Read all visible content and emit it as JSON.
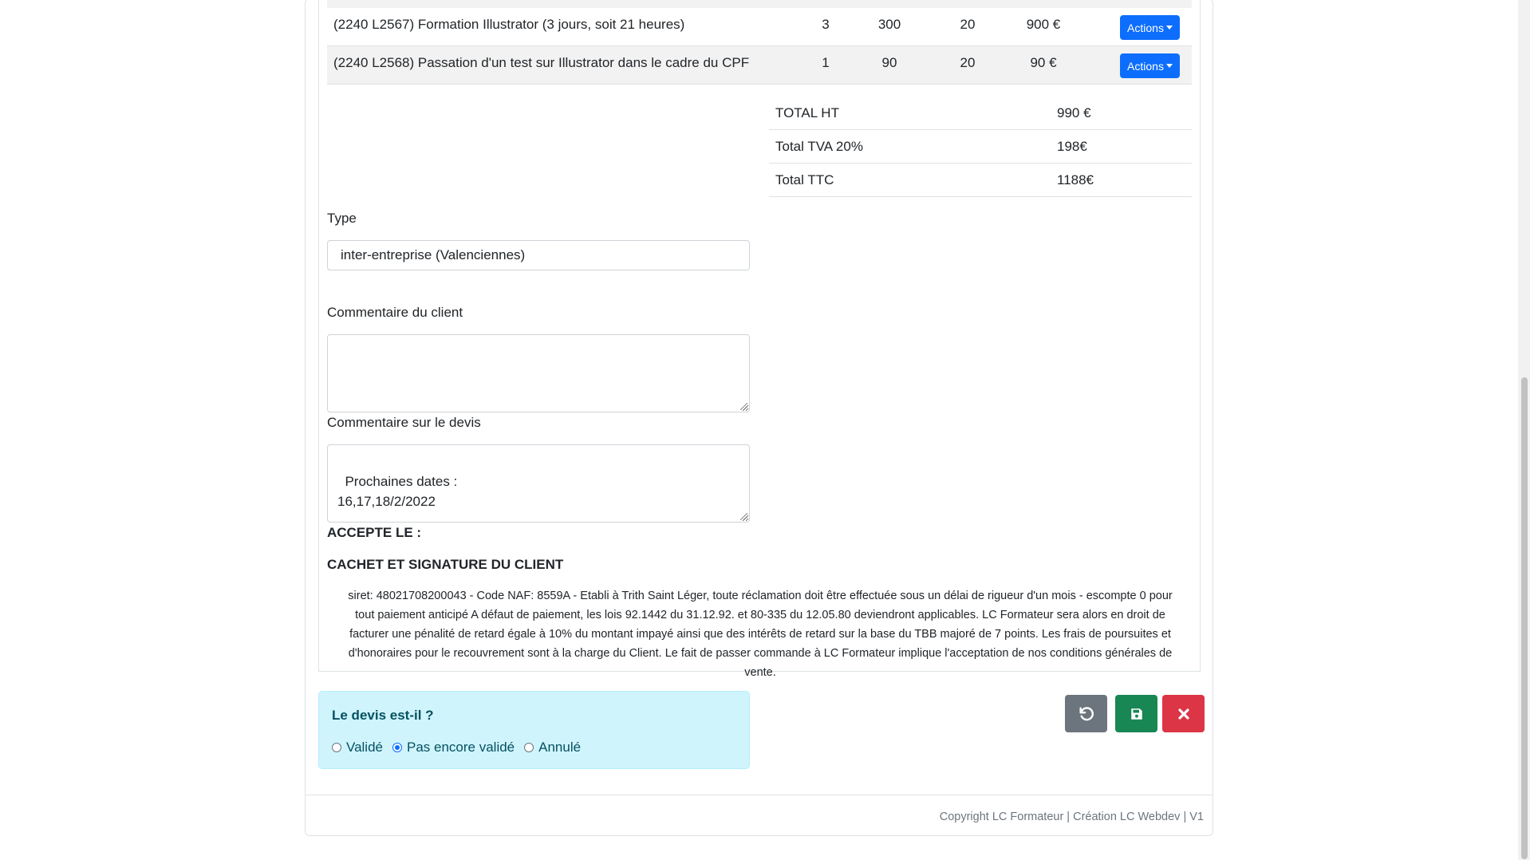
{
  "lines": [
    {
      "designation": "(2240 L2567) Formation Illustrator (3 jours, soit 21 heures)",
      "qty": "3",
      "price": "300",
      "vat": "20",
      "total": "900 €",
      "actions_label": "Actions"
    },
    {
      "designation": "(2240 L2568) Passation d'un test sur Illustrator dans le cadre du CPF",
      "qty": "1",
      "price": "90",
      "vat": "20",
      "total": "90 €",
      "actions_label": "Actions"
    }
  ],
  "totals": [
    {
      "label": "TOTAL HT",
      "value": "990 €"
    },
    {
      "label": "Total TVA 20%",
      "value": "198€"
    },
    {
      "label": "Total TTC",
      "value": "1188€"
    }
  ],
  "form": {
    "type_label": "Type",
    "type_value": "inter-entreprise (Valenciennes)",
    "client_comment_label": "Commentaire du client",
    "client_comment_value": "",
    "quote_comment_label": "Commentaire sur le devis",
    "quote_comment_value": "Prochaines dates :\n16,17,18/2/2022"
  },
  "signature": {
    "accepted_label": "ACCEPTE LE :",
    "stamp_label": "CACHET ET SIGNATURE DU CLIENT"
  },
  "legal_text": "siret: 48021708200043 - Code NAF: 8559A - Etabli à Trith Saint Léger, toute réclamation doit être effectuée sous un délai de rigueur d'un mois - escompte 0 pour tout paiement anticipé A défaut de paiement, les lois 92.1442 du 31.12.92. et 80-335 du 12.05.80 deviendront applicables. LC Formateur sera alors en droit de facturer une pénalité de retard égale à 10% du montant impayé ainsi que des intérêts de retard sur la base du TBB majoré de 7 points. Les frais de poursuites et d'honoraires pour le recouvrement sont à la charge du Client. Le fait de passer commande à LC Formateur implique l'acceptation de nos conditions générales de vente.",
  "status": {
    "question": "Le devis est-il ?",
    "options": [
      {
        "label": "Validé",
        "checked": false
      },
      {
        "label": "Pas encore validé",
        "checked": true
      },
      {
        "label": "Annulé",
        "checked": false
      }
    ]
  },
  "action_buttons": [
    {
      "icon": "undo-icon",
      "color": "#6c757d"
    },
    {
      "icon": "save-icon",
      "color": "#198754"
    },
    {
      "icon": "close-icon",
      "color": "#dc3545"
    }
  ],
  "footer": {
    "text": "Copyright LC Formateur | Création LC Webdev | V1"
  }
}
